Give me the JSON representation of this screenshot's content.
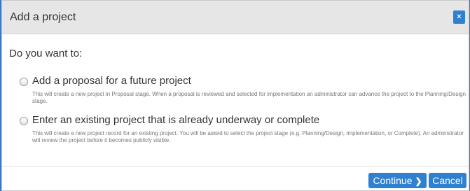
{
  "dialog": {
    "title": "Add a project",
    "close_glyph": "×",
    "prompt": "Do you want to:",
    "options": [
      {
        "label": "Add a proposal for a future project",
        "description": "This will create a new project in Proposal stage. When a proposal is reviewed and selected for implementation an administrator can advance the project to the Planning/Design stage.",
        "selected": false
      },
      {
        "label": "Enter an existing project that is already underway or complete",
        "description": "This will create a new project record for an existing project. You will be asked to select the project stage (e.g. Planning/Design, Implementation, or Complete). An administrator will review the project before it becomes publicly visible.",
        "selected": false
      }
    ],
    "buttons": {
      "continue_label": "Continue",
      "continue_icon": "chevron-right-icon",
      "cancel_label": "Cancel"
    }
  },
  "colors": {
    "accent": "#2f80d1",
    "header_bg": "#e6e6e6",
    "backdrop": "#3a78c8"
  }
}
